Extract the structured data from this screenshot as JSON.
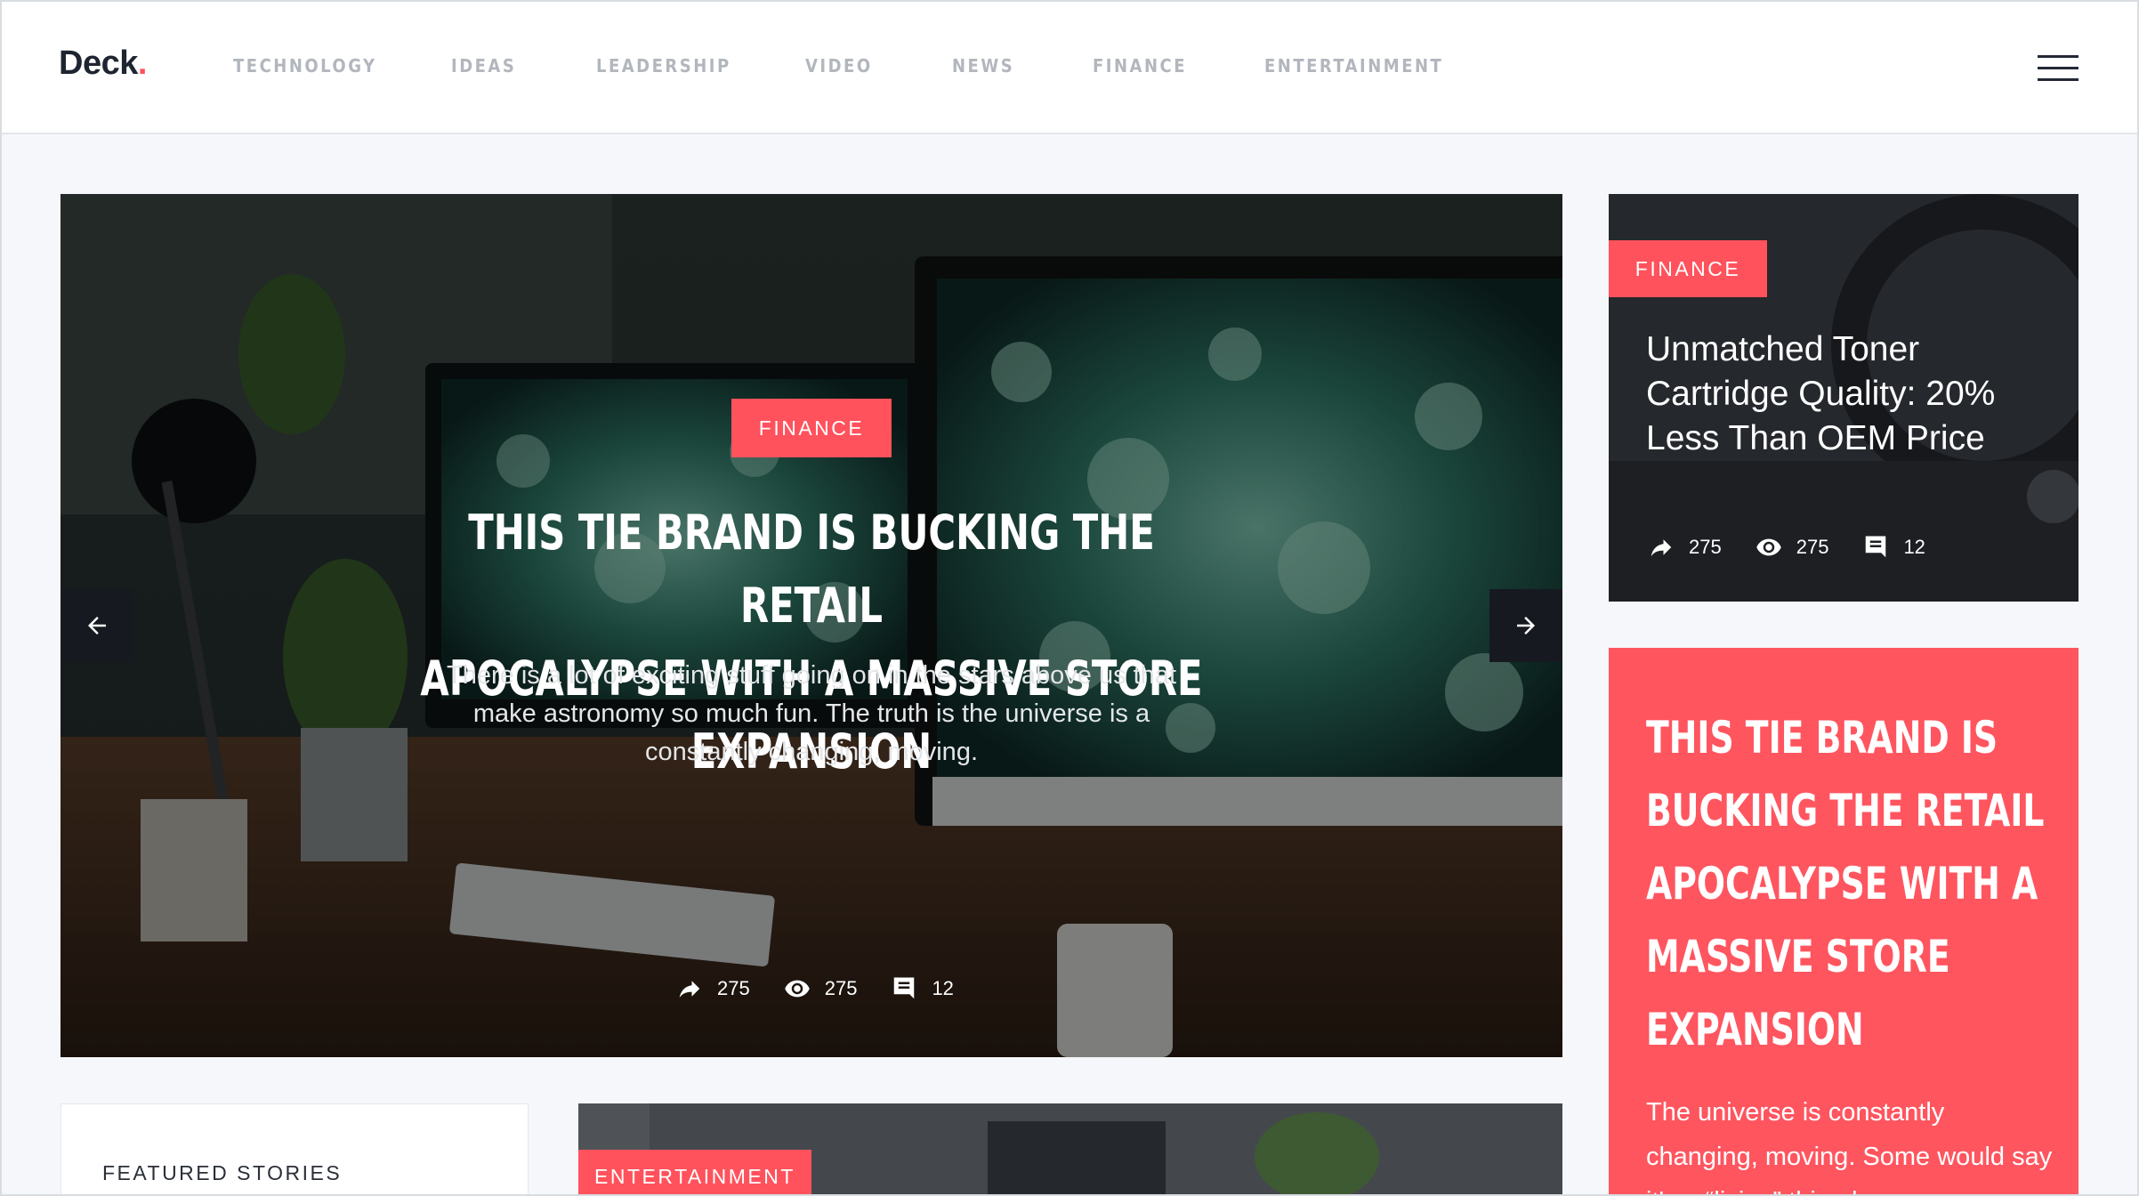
{
  "header": {
    "logo_text": "Deck",
    "logo_dot": ".",
    "nav": [
      {
        "label": "TECHNOLOGY"
      },
      {
        "label": "IDEAS"
      },
      {
        "label": "LEADERSHIP"
      },
      {
        "label": "VIDEO"
      },
      {
        "label": "NEWS"
      },
      {
        "label": "FINANCE"
      },
      {
        "label": "ENTERTAINMENT"
      }
    ],
    "menu_icon": "hamburger-menu-icon"
  },
  "hero": {
    "category": "FINANCE",
    "title_line1": "THIS TIE BRAND IS BUCKING THE RETAIL",
    "title_line2": "APOCALYPSE WITH A MASSIVE STORE EXPANSION",
    "excerpt": "There is a lot of exciting stuff going on in the stars above us that make astronomy so much fun. The truth is the universe is a constantly changing, moving.",
    "shares": "275",
    "views": "275",
    "comments": "12",
    "prev_icon": "arrow-left-icon",
    "next_icon": "arrow-right-icon"
  },
  "side_card": {
    "category": "FINANCE",
    "title": "Unmatched Toner Cartridge Quality: 20% Less Than OEM Price",
    "shares": "275",
    "views": "275",
    "comments": "12"
  },
  "promo_card": {
    "title": "THIS TIE BRAND IS BUCKING THE RETAIL APOCALYPSE WITH A MASSIVE STORE EXPANSION",
    "text": "The universe is constantly changing, moving. Some would say it's a “living” thing because"
  },
  "featured": {
    "label": "FEATURED STORIES"
  },
  "bottom_card": {
    "category": "ENTERTAINMENT"
  },
  "colors": {
    "accent": "#ff525c",
    "nav_text": "#b2b6bd",
    "page_bg": "#f5f7fa",
    "dark": "#1f2530"
  }
}
